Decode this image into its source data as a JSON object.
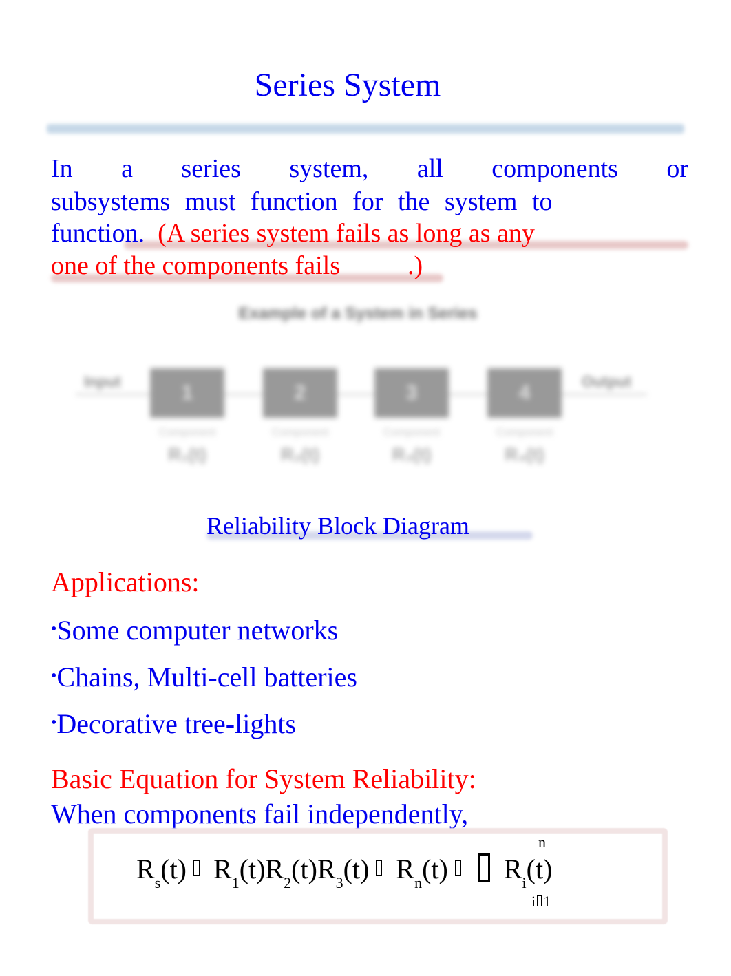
{
  "title": "Series System",
  "intro": {
    "line1_words": [
      "In",
      "a",
      "series",
      "system,",
      "all",
      "components",
      "or"
    ],
    "line2": "subsystems must function for the system to",
    "line3_blue": "function.",
    "line3_red": "(A series system fails as long as any",
    "line4_red": "one of the components fails",
    "line4_tail": ".)"
  },
  "diagram": {
    "title": "Example of a System in Series",
    "input_label": "Input",
    "output_label": "Output",
    "blocks": [
      {
        "number": "1",
        "caption": "Component",
        "reliability": "R₁(t)"
      },
      {
        "number": "2",
        "caption": "Component",
        "reliability": "R₂(t)"
      },
      {
        "number": "3",
        "caption": "Component",
        "reliability": "R₃(t)"
      },
      {
        "number": "4",
        "caption": "Component",
        "reliability": "R₄(t)"
      }
    ],
    "caption": "Reliability Block Diagram"
  },
  "applications": {
    "heading": "Applications:",
    "bullet_symbol": "•",
    "items": [
      "Some computer networks",
      "Chains, Multi-cell batteries",
      "Decorative tree-lights"
    ]
  },
  "equation": {
    "heading": "Basic Equation for System Reliability:",
    "intro": "When components fail independently,",
    "R": "R",
    "t": "(t)",
    "subs": [
      "s",
      "1",
      "2",
      "3",
      "n",
      "i"
    ],
    "upper_limit": "n",
    "lower_limit_i": "i",
    "lower_limit_1": "1"
  },
  "colors": {
    "text_blue": "#0000ee",
    "text_red": "#ff0000",
    "title_rule": "#c6d8e8"
  }
}
